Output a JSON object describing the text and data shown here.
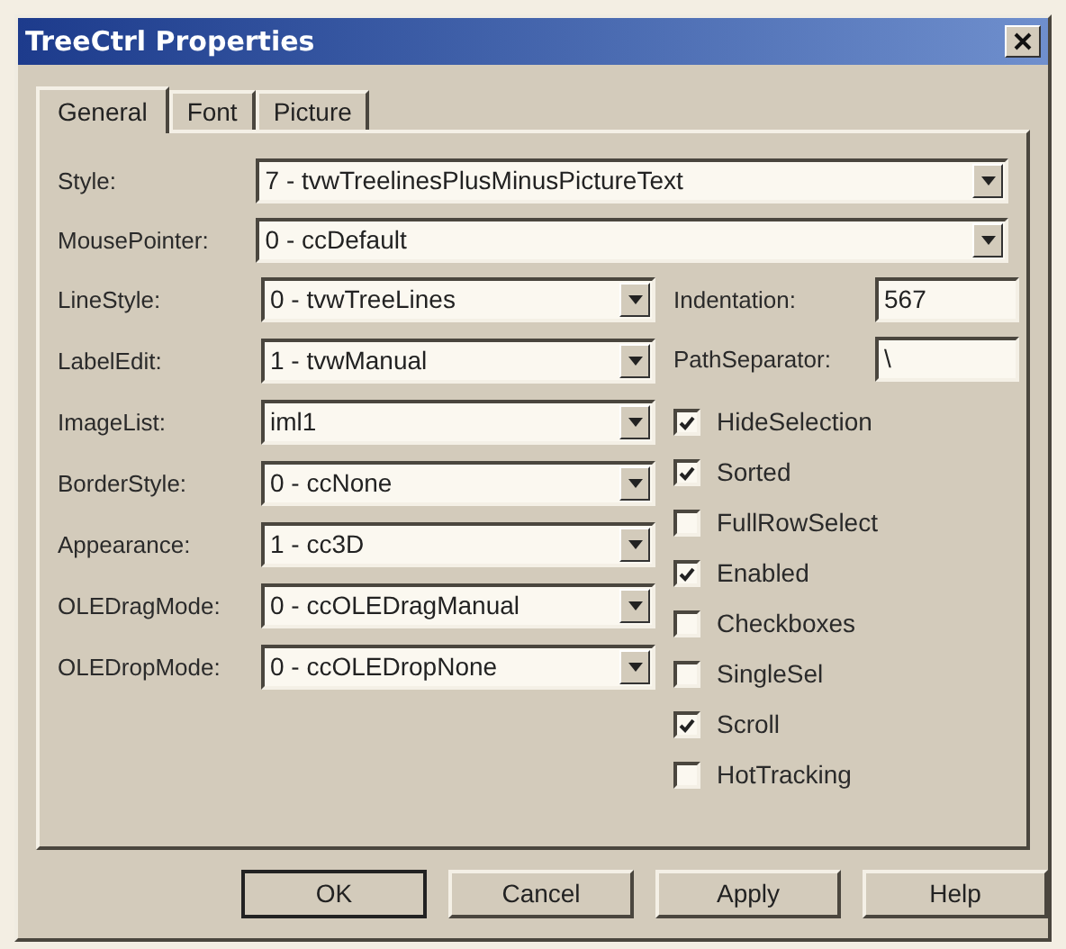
{
  "window": {
    "title": "TreeCtrl Properties"
  },
  "tabs": [
    {
      "label": "General",
      "selected": true
    },
    {
      "label": "Font",
      "selected": false
    },
    {
      "label": "Picture",
      "selected": false
    }
  ],
  "wide_fields": [
    {
      "label": "Style:",
      "value": "7 - tvwTreelinesPlusMinusPictureText"
    },
    {
      "label": "MousePointer:",
      "value": "0 - ccDefault"
    }
  ],
  "fields": [
    {
      "label": "LineStyle:",
      "value": "0 - tvwTreeLines"
    },
    {
      "label": "LabelEdit:",
      "value": "1 - tvwManual"
    },
    {
      "label": "ImageList:",
      "value": "iml1"
    },
    {
      "label": "BorderStyle:",
      "value": "0 - ccNone"
    },
    {
      "label": "Appearance:",
      "value": "1 - cc3D"
    },
    {
      "label": "OLEDragMode:",
      "value": "0 - ccOLEDragManual"
    },
    {
      "label": "OLEDropMode:",
      "value": "0 - ccOLEDropNone"
    }
  ],
  "text_fields": [
    {
      "label": "Indentation:",
      "value": "567"
    },
    {
      "label": "PathSeparator:",
      "value": "\\"
    }
  ],
  "checkboxes": [
    {
      "label": "HideSelection",
      "checked": true
    },
    {
      "label": "Sorted",
      "checked": true
    },
    {
      "label": "FullRowSelect",
      "checked": false
    },
    {
      "label": "Enabled",
      "checked": true
    },
    {
      "label": "Checkboxes",
      "checked": false
    },
    {
      "label": "SingleSel",
      "checked": false
    },
    {
      "label": "Scroll",
      "checked": true
    },
    {
      "label": "HotTracking",
      "checked": false
    }
  ],
  "buttons": [
    {
      "label": "OK",
      "default": true
    },
    {
      "label": "Cancel",
      "default": false
    },
    {
      "label": "Apply",
      "default": false
    },
    {
      "label": "Help",
      "default": false
    }
  ]
}
